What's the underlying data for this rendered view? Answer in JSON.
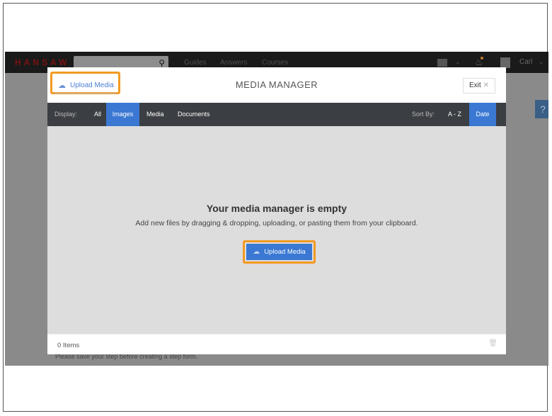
{
  "site": {
    "logo": "HANSAW",
    "nav": [
      "Guides",
      "Answers",
      "Courses"
    ],
    "user_name": "Carl",
    "help_label": "?",
    "footnote": "Please save your step before creating a step form."
  },
  "modal": {
    "title": "MEDIA MANAGER",
    "upload_label": "Upload Media",
    "exit_label": "Exit",
    "exit_close": "✕",
    "display_label": "Display:",
    "filters": [
      "All",
      "Images",
      "Media",
      "Documents"
    ],
    "active_filter": "Images",
    "sort_label": "Sort By:",
    "sorts": [
      "A - Z",
      "Date"
    ],
    "active_sort": "Date",
    "empty_title": "Your media manager is empty",
    "empty_sub": "Add new files by dragging & dropping, uploading, or pasting them from your clipboard.",
    "upload_button_label": "Upload Media",
    "item_count": "0 Items"
  },
  "colors": {
    "accent": "#3a78d3",
    "highlight": "#f39a22",
    "toolbar": "#3b3e42",
    "empty_bg": "#dddddd"
  },
  "icons": {
    "cloud": "cloud-upload-icon",
    "search": "search-icon",
    "bell": "bell-icon",
    "trash": "trash-icon"
  }
}
